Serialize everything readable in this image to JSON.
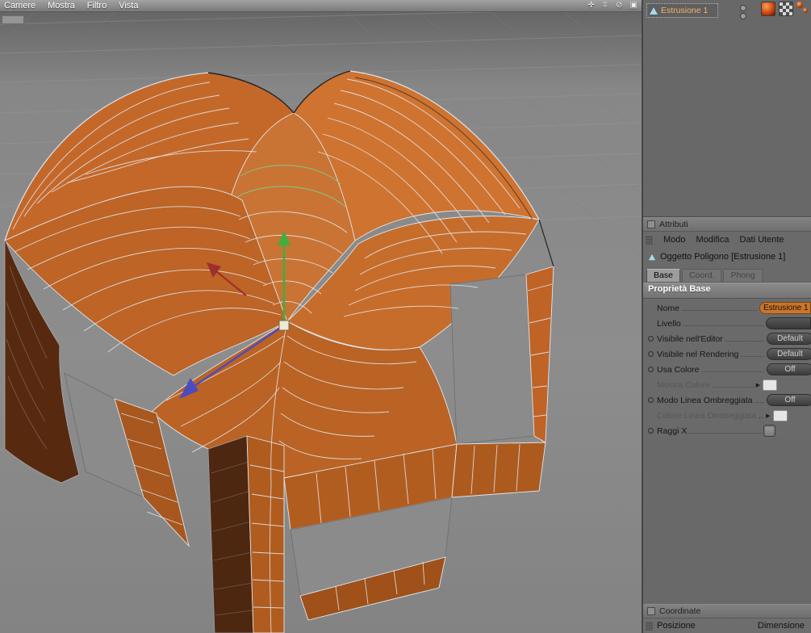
{
  "menu_bar": {
    "items": [
      {
        "label": "Camere"
      },
      {
        "label": "Mostra"
      },
      {
        "label": "Filtro"
      },
      {
        "label": "Vista"
      }
    ]
  },
  "viewport": {
    "nav_icons": [
      {
        "name": "pan-icon",
        "glyph": "✛"
      },
      {
        "name": "zoom-icon",
        "glyph": "⇳"
      },
      {
        "name": "rotate-icon",
        "glyph": "⊘"
      },
      {
        "name": "toggle-view-icon",
        "glyph": "▣"
      }
    ]
  },
  "object_manager": {
    "items": [
      {
        "label": "Estrusione 1",
        "icon": "extrude-object-icon"
      }
    ],
    "thumbnails": [
      {
        "name": "material-sphere"
      },
      {
        "name": "material-checker"
      }
    ]
  },
  "attributes": {
    "title": "Attributi",
    "menu_tabs": [
      {
        "label": "Modo"
      },
      {
        "label": "Modifica"
      },
      {
        "label": "Dati Utente"
      }
    ],
    "object_label": "Oggetto Poligono [Estrusione 1]",
    "subtabs": [
      {
        "label": "Base",
        "active": true
      },
      {
        "label": "Coord.",
        "active": false
      },
      {
        "label": "Phong",
        "active": false
      }
    ],
    "section_title": "Proprietà Base",
    "rows": [
      {
        "label": "Nome",
        "control": "name-field",
        "value": "Estrusione 1",
        "bullet": false
      },
      {
        "label": "Livello",
        "control": "field",
        "bullet": false
      },
      {
        "label": "Visibile nell'Editor",
        "control": "button",
        "value": "Default",
        "bullet": true
      },
      {
        "label": "Visibile nel Rendering",
        "control": "button",
        "value": "Default",
        "bullet": true
      },
      {
        "label": "Usa Colore",
        "control": "button",
        "value": "Off",
        "bullet": true
      },
      {
        "label": "Mostra Colore",
        "control": "swatch",
        "bullet": false,
        "arrow": true,
        "disabled": true
      },
      {
        "label": "Modo Linea Ombreggiata",
        "control": "button",
        "value": "Off",
        "bullet": true
      },
      {
        "label": "Colore Linea Ombreggiata",
        "control": "swatch",
        "bullet": false,
        "arrow": true,
        "disabled": true
      },
      {
        "label": "Raggi X",
        "control": "checkbox",
        "bullet": true
      }
    ]
  },
  "coordinates": {
    "title": "Coordinate",
    "columns": [
      {
        "label": "Posizione"
      },
      {
        "label": "Dimensione"
      }
    ]
  },
  "colors": {
    "mesh_orange": "#c96f2e",
    "mesh_dark_side": "#572a10",
    "wireframe": "#e3ebf3",
    "isoline_green": "#7ccf8e",
    "axis_x": "#9e2f2f",
    "axis_y": "#3fae3f",
    "axis_z": "#4b4bc0",
    "viewport_bg": "#8a8a8a",
    "panel_bg": "#6a6a6a"
  }
}
